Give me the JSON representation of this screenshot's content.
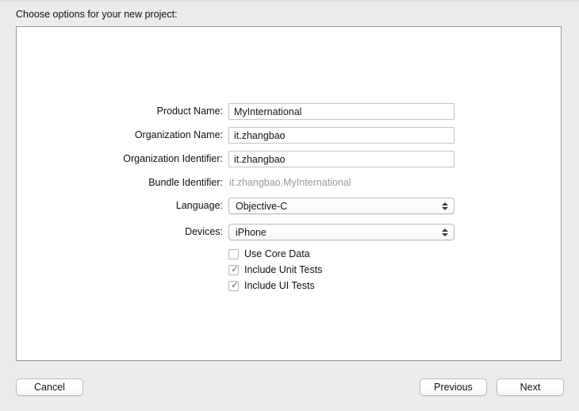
{
  "dialog": {
    "title": "Choose options for your new project:"
  },
  "form": {
    "rows": [
      {
        "label": "Product Name:",
        "type": "text",
        "value": "MyInternational",
        "placeholder": ""
      },
      {
        "label": "Organization Name:",
        "type": "text",
        "value": "it.zhangbao",
        "placeholder": ""
      },
      {
        "label": "Organization Identifier:",
        "type": "text",
        "value": "it.zhangbao",
        "placeholder": ""
      },
      {
        "label": "Bundle Identifier:",
        "type": "static",
        "value": "it.zhangbao.MyInternational"
      },
      {
        "label": "Language:",
        "type": "popup",
        "value": "Objective-C"
      },
      {
        "label": "Devices:",
        "type": "popup",
        "value": "iPhone"
      }
    ]
  },
  "options": {
    "checkboxes": [
      {
        "label": "Use Core Data",
        "checked": false,
        "mark": ""
      },
      {
        "label": "Include Unit Tests",
        "checked": true,
        "mark": "✓"
      },
      {
        "label": "Include UI Tests",
        "checked": true,
        "mark": "✓"
      }
    ]
  },
  "footer": {
    "cancel_label": "Cancel",
    "previous_label": "Previous",
    "next_label": "Next"
  },
  "colors": {
    "window_background": "#ececec",
    "panel_background": "#ffffff",
    "panel_border": "#979797",
    "text": "#111111",
    "muted_text": "#9a9a9a",
    "field_border": "#c3c3c3"
  }
}
